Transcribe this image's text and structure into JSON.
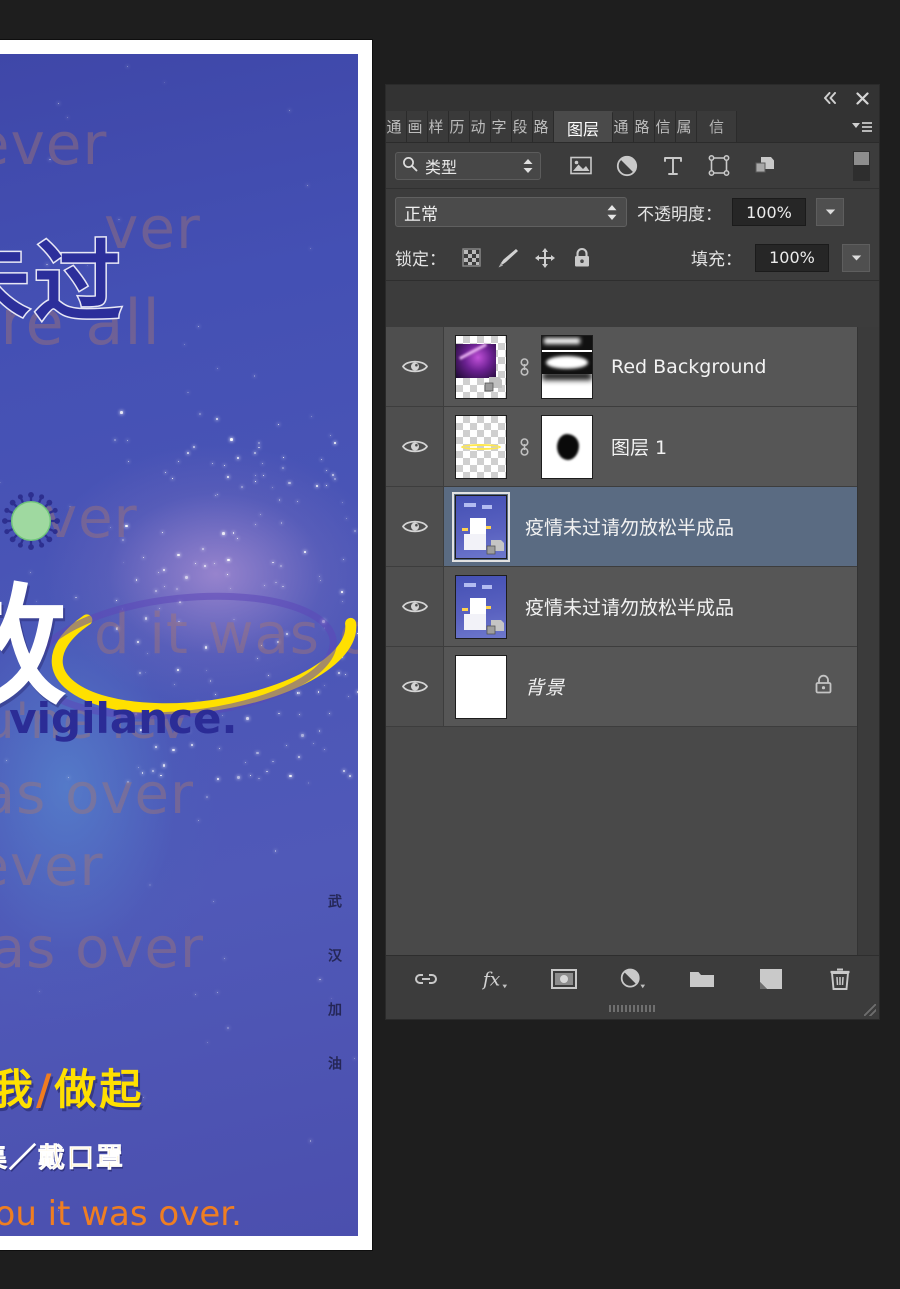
{
  "app": {
    "panel_title": "图层",
    "collapse_icon": "double-chevron-left-icon",
    "close_icon": "close-icon",
    "menu_icon": "panel-menu-icon"
  },
  "tabs": {
    "truncated_left": [
      "通",
      "画",
      "样",
      "历",
      "动",
      "字",
      "段",
      "路"
    ],
    "active": "图层",
    "truncated_right": [
      "通",
      "路",
      "信",
      "属"
    ],
    "right_extra": "信"
  },
  "filter_row": {
    "search_icon": "search-icon",
    "filter_label": "类型",
    "stepper_icon": "stepper-updown-icon",
    "icons": [
      {
        "name": "pixel-layer-filter-icon",
        "label": "像素图层"
      },
      {
        "name": "adjustment-layer-filter-icon",
        "label": "调整图层"
      },
      {
        "name": "type-layer-filter-icon",
        "label": "文字图层"
      },
      {
        "name": "shape-layer-filter-icon",
        "label": "形状图层"
      },
      {
        "name": "smart-object-filter-icon",
        "label": "智能对象"
      }
    ],
    "toggle_name": "filter-enable-toggle"
  },
  "blend_row": {
    "mode": "正常",
    "opacity_label": "不透明度：",
    "opacity_value": "100%",
    "dropdown_icon": "chevron-down-icon"
  },
  "lock_row": {
    "lock_label": "锁定：",
    "buttons": [
      {
        "name": "lock-transparent-pixels-icon"
      },
      {
        "name": "lock-image-pixels-brush-icon"
      },
      {
        "name": "lock-position-move-icon"
      },
      {
        "name": "lock-all-padlock-icon"
      }
    ],
    "fill_label": "填充：",
    "fill_value": "100%",
    "dropdown_icon": "chevron-down-icon"
  },
  "layers": [
    {
      "name": "Red Background",
      "visible": true,
      "selected": false,
      "thumb": "galaxy-purple",
      "has_mask": true,
      "mask": "blob-horizontal",
      "linked": true,
      "locked": false,
      "smart_object": true,
      "name_style": "latin"
    },
    {
      "name": "图层 1",
      "visible": true,
      "selected": false,
      "thumb": "transparent-yellow-swoosh",
      "has_mask": true,
      "mask": "blob-round",
      "linked": true,
      "locked": false,
      "smart_object": false,
      "name_style": "cjk"
    },
    {
      "name": "疫情未过请勿放松半成品",
      "visible": true,
      "selected": true,
      "thumb": "poster-preview",
      "has_mask": false,
      "linked": false,
      "locked": false,
      "smart_object": true,
      "name_style": "cjk"
    },
    {
      "name": "疫情未过请勿放松半成品",
      "visible": true,
      "selected": false,
      "thumb": "poster-preview",
      "has_mask": false,
      "linked": false,
      "locked": false,
      "smart_object": true,
      "name_style": "cjk"
    },
    {
      "name": "背景",
      "visible": true,
      "selected": false,
      "thumb": "white",
      "has_mask": false,
      "linked": false,
      "locked": true,
      "smart_object": false,
      "name_style": "cjk-italic"
    }
  ],
  "bottom_toolbar": [
    {
      "name": "link-layers-icon",
      "label": "链接图层"
    },
    {
      "name": "layer-style-fx-icon",
      "label": "添加图层样式"
    },
    {
      "name": "add-layer-mask-icon",
      "label": "添加图层蒙版"
    },
    {
      "name": "new-adjustment-layer-icon",
      "label": "创建新的填充或调整图层"
    },
    {
      "name": "new-group-folder-icon",
      "label": "创建新组"
    },
    {
      "name": "new-layer-icon",
      "label": "创建新图层"
    },
    {
      "name": "delete-layer-trash-icon",
      "label": "删除图层"
    }
  ],
  "poster": {
    "watermarks": [
      "never",
      "u're all",
      "ver",
      "ver",
      "was over",
      "d it was over",
      "never",
      "was over",
      "nu'ne lev"
    ],
    "title_cn": "未过",
    "title_cn2": "放",
    "subtitle_en": "ur vigilance.",
    "slogan_main_a": "从我",
    "slogan_slash": "/",
    "slogan_main_b": "做起",
    "slogan_sub": "不聚集／戴口罩",
    "tagline_en": "d you it was over.",
    "vertical_text": "武汉加油",
    "virus_icon": "coronavirus-icon"
  },
  "colors": {
    "panel_bg": "#3c3c3c",
    "list_bg": "#565656",
    "selected_row": "#5a6b82",
    "text": "#f2f2f2",
    "poster_blue": "#4450b4",
    "accent_yellow": "#ffe000",
    "accent_orange": "#ef7e22"
  }
}
